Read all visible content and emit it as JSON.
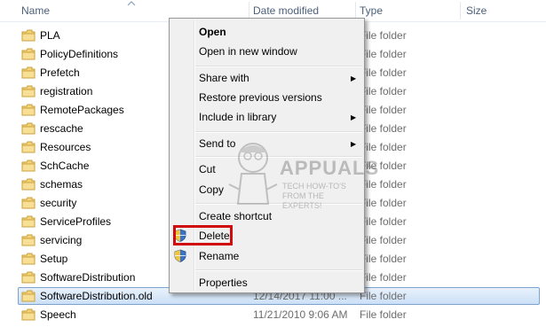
{
  "header": {
    "name_label": "Name",
    "date_label": "Date modified",
    "type_label": "Type",
    "size_label": "Size"
  },
  "rows": [
    {
      "name": "PLA",
      "date": "",
      "type": "File folder"
    },
    {
      "name": "PolicyDefinitions",
      "date": "",
      "type": "File folder"
    },
    {
      "name": "Prefetch",
      "date": "",
      "type": "File folder"
    },
    {
      "name": "registration",
      "date": "",
      "type": "File folder"
    },
    {
      "name": "RemotePackages",
      "date": "",
      "type": "File folder"
    },
    {
      "name": "rescache",
      "date": "",
      "type": "File folder"
    },
    {
      "name": "Resources",
      "date": "",
      "type": "File folder"
    },
    {
      "name": "SchCache",
      "date": "",
      "type": "File folder"
    },
    {
      "name": "schemas",
      "date": "",
      "type": "File folder"
    },
    {
      "name": "security",
      "date": "",
      "type": "File folder"
    },
    {
      "name": "ServiceProfiles",
      "date": "",
      "type": "File folder"
    },
    {
      "name": "servicing",
      "date": "",
      "type": "File folder"
    },
    {
      "name": "Setup",
      "date": "",
      "type": "File folder"
    },
    {
      "name": "SoftwareDistribution",
      "date": "",
      "type": "File folder"
    },
    {
      "name": "SoftwareDistribution.old",
      "date": "12/14/2017 11:00 ...",
      "type": "File folder"
    },
    {
      "name": "Speech",
      "date": "11/21/2010 9:06 AM",
      "type": "File folder"
    }
  ],
  "context_menu": {
    "open": "Open",
    "open_new_window": "Open in new window",
    "share_with": "Share with",
    "restore_previous": "Restore previous versions",
    "include_in_library": "Include in library",
    "send_to": "Send to",
    "cut": "Cut",
    "copy": "Copy",
    "create_shortcut": "Create shortcut",
    "delete": "Delete",
    "rename": "Rename",
    "properties": "Properties"
  },
  "watermark": {
    "title": "APPUALS",
    "tagline": "TECH HOW-TO'S FROM THE EXPERTS!"
  },
  "colors": {
    "highlight_box": "#d00b0b",
    "selection_border": "#7da2ce",
    "header_text": "#4c607a"
  },
  "icons": [
    "folder-icon",
    "uac-shield-icon",
    "submenu-arrow-icon",
    "sort-caret-icon"
  ]
}
